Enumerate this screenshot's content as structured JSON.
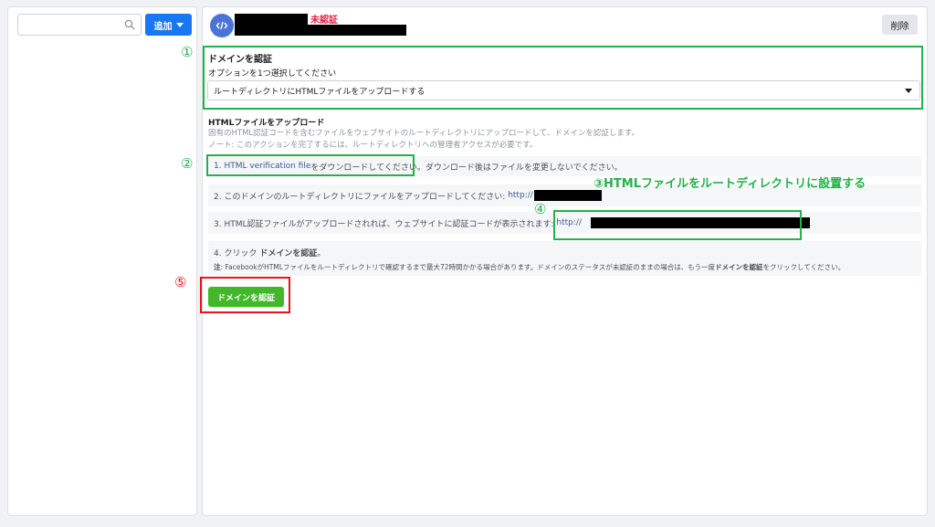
{
  "sidebar": {
    "search_placeholder": "",
    "add_button": "追加"
  },
  "header": {
    "status": "未認証",
    "delete_button": "削除"
  },
  "verify_section": {
    "title": "ドメインを認証",
    "subtitle": "オプションを1つ選択してください",
    "selected_option": "ルートディレクトリにHTMLファイルをアップロードする"
  },
  "upload_section": {
    "title": "HTMLファイルをアップロード",
    "description": "固有のHTML認証コードを含むファイルをウェブサイトのルートディレクトリにアップロードして、ドメインを認証します。",
    "note": "ノート: このアクションを完了するには、ルートディレクトリへの管理者アクセスが必要です。"
  },
  "steps": {
    "step1_prefix": "1. ",
    "step1_link": "HTML verification file",
    "step1_text": "をダウンロードしてください。ダウンロード後はファイルを変更しないでください。",
    "step2_text": "2. このドメインのルートディレクトリにファイルをアップロードしてください: ",
    "step2_link": "http://",
    "step3_text": "3. HTML認証ファイルがアップロードされれば、ウェブサイトに認証コードが表示されます: ",
    "step3_link": "http://",
    "step4_text": "4. クリック ",
    "step4_bold": "ドメインを認証",
    "step4_end": "。",
    "step4_note_label": "注",
    "step4_note": ": FacebookがHTMLファイルをルートディレクトリで確認するまで最大72時間かかる場合があります。ドメインのステータスが未認証のままの場合は、もう一度",
    "step4_note_bold": "ドメインを認証",
    "step4_note_end": "をクリックしてください。"
  },
  "verify_button": "ドメインを認証",
  "annotations": {
    "num1": "①",
    "num2": "②",
    "num3_text": "③HTMLファイルをルートディレクトリに設置する",
    "num4": "④",
    "num5": "⑤"
  },
  "colors": {
    "accent_blue": "#1877f2",
    "green_button": "#42b72a",
    "annotation_green": "#22b14c",
    "annotation_red": "#e81123",
    "status_red": "#e41e3f"
  }
}
